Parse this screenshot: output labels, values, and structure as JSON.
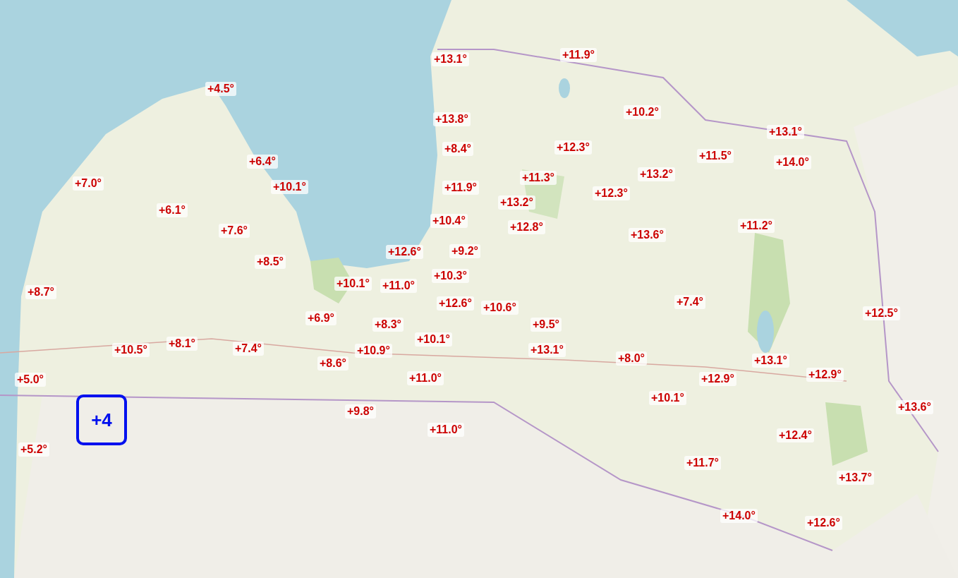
{
  "temperature_labels": [
    {
      "text": "+13.1°"
    },
    {
      "text": "+11.9°"
    },
    {
      "text": "+4.5°"
    },
    {
      "text": "+10.2°"
    },
    {
      "text": "+13.8°"
    },
    {
      "text": "+13.1°"
    },
    {
      "text": "+8.4°"
    },
    {
      "text": "+12.3°"
    },
    {
      "text": "+6.4°"
    },
    {
      "text": "+11.5°"
    },
    {
      "text": "+14.0°"
    },
    {
      "text": "+13.2°"
    },
    {
      "text": "+11.3°"
    },
    {
      "text": "+7.0°"
    },
    {
      "text": "+10.1°"
    },
    {
      "text": "+11.9°"
    },
    {
      "text": "+12.3°"
    },
    {
      "text": "+6.1°"
    },
    {
      "text": "+13.2°"
    },
    {
      "text": "+10.4°"
    },
    {
      "text": "+12.8°"
    },
    {
      "text": "+7.6°"
    },
    {
      "text": "+13.6°"
    },
    {
      "text": "+11.2°"
    },
    {
      "text": "+12.6°"
    },
    {
      "text": "+9.2°"
    },
    {
      "text": "+8.5°"
    },
    {
      "text": "+10.3°"
    },
    {
      "text": "+10.1°"
    },
    {
      "text": "+11.0°"
    },
    {
      "text": "+8.7°"
    },
    {
      "text": "+12.6°"
    },
    {
      "text": "+10.6°"
    },
    {
      "text": "+7.4°"
    },
    {
      "text": "+12.5°"
    },
    {
      "text": "+6.9°"
    },
    {
      "text": "+8.3°"
    },
    {
      "text": "+9.5°"
    },
    {
      "text": "+10.1°"
    },
    {
      "text": "+10.5°"
    },
    {
      "text": "+8.1°"
    },
    {
      "text": "+7.4°"
    },
    {
      "text": "+8.6°"
    },
    {
      "text": "+10.9°"
    },
    {
      "text": "+13.1°"
    },
    {
      "text": "+8.0°"
    },
    {
      "text": "+13.1°"
    },
    {
      "text": "+5.0°"
    },
    {
      "text": "+11.0°"
    },
    {
      "text": "+12.9°"
    },
    {
      "text": "+12.9°"
    },
    {
      "text": "+10.1°"
    },
    {
      "text": "+13.6°"
    },
    {
      "text": "+9.8°"
    },
    {
      "text": "+11.0°"
    },
    {
      "text": "+12.4°"
    },
    {
      "text": "+5.2°"
    },
    {
      "text": "+11.7°"
    },
    {
      "text": "+13.7°"
    },
    {
      "text": "+14.0°"
    },
    {
      "text": "+12.6°"
    }
  ],
  "highlight_box": {
    "text": "+4"
  }
}
